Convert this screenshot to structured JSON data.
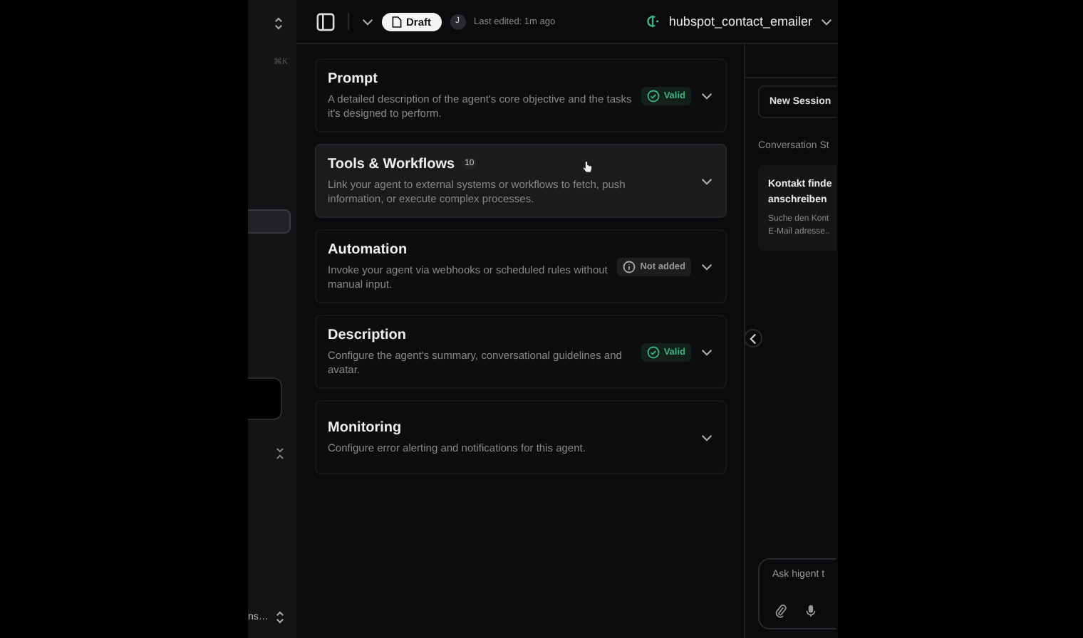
{
  "sidebar": {
    "shortcut": "⌘K",
    "footer_text": "ns…"
  },
  "header": {
    "status": "Draft",
    "avatar": "J",
    "last_edited": "Last edited: 1m ago",
    "agent_name": "hubspot_contact_emailer"
  },
  "sections": [
    {
      "title": "Prompt",
      "description": "A detailed description of the agent's core objective and the tasks it's designed to perform.",
      "status": {
        "kind": "valid",
        "label": "Valid"
      },
      "hovered": false
    },
    {
      "title": "Tools & Workflows",
      "count": "10",
      "description": "Link your agent to external systems or workflows to fetch, push information, or execute complex processes.",
      "hovered": true
    },
    {
      "title": "Automation",
      "description": "Invoke your agent via webhooks or scheduled rules without manual input.",
      "status": {
        "kind": "not_added",
        "label": "Not added"
      },
      "hovered": false
    },
    {
      "title": "Description",
      "description": "Configure the agent's summary, conversational guidelines and avatar.",
      "status": {
        "kind": "valid",
        "label": "Valid"
      },
      "hovered": false
    },
    {
      "title": "Monitoring",
      "description": "Configure error alerting and notifications for this agent.",
      "hovered": false
    }
  ],
  "chat": {
    "new_session": "New Session",
    "starters_label": "Conversation St",
    "starter": {
      "title_lines": [
        "Kontakt finde",
        "anschreiben"
      ],
      "description_lines": [
        "Suche den Kont",
        "E-Mail adresse.."
      ]
    },
    "input_placeholder": "Ask higent t"
  }
}
